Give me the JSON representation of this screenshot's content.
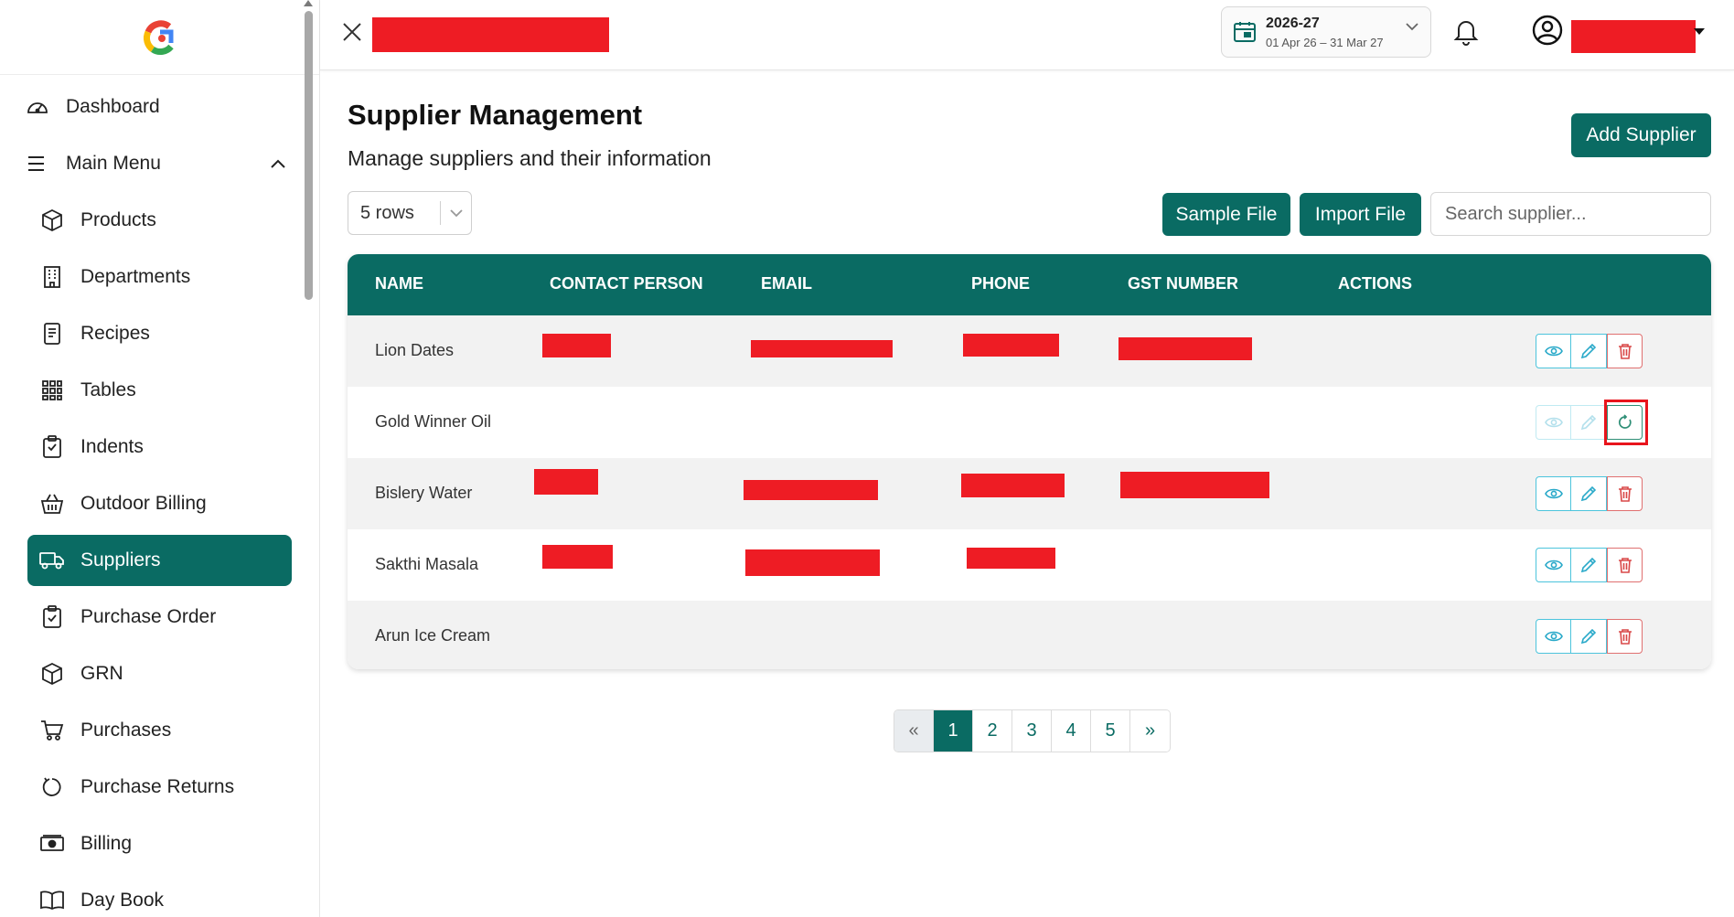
{
  "sidebar": {
    "items": [
      {
        "label": "Dashboard",
        "icon": "gauge-icon"
      },
      {
        "label": "Main Menu",
        "icon": "menu-icon"
      },
      {
        "label": "Products",
        "icon": "box-icon"
      },
      {
        "label": "Departments",
        "icon": "building-icon"
      },
      {
        "label": "Recipes",
        "icon": "receipt-icon"
      },
      {
        "label": "Tables",
        "icon": "grid-icon"
      },
      {
        "label": "Indents",
        "icon": "clipboard-icon"
      },
      {
        "label": "Outdoor Billing",
        "icon": "basket-icon"
      },
      {
        "label": "Suppliers",
        "icon": "truck-icon"
      },
      {
        "label": "Purchase Order",
        "icon": "clipboard-check-icon"
      },
      {
        "label": "GRN",
        "icon": "box-icon"
      },
      {
        "label": "Purchases",
        "icon": "cart-icon"
      },
      {
        "label": "Purchase Returns",
        "icon": "return-icon"
      },
      {
        "label": "Billing",
        "icon": "cash-icon"
      },
      {
        "label": "Day Book",
        "icon": "book-icon"
      }
    ],
    "active": "Suppliers"
  },
  "header": {
    "fy_year": "2026-27",
    "fy_range": "01 Apr 26 – 31 Mar 27"
  },
  "main": {
    "title": "Supplier Management",
    "subtitle": "Manage suppliers and their information",
    "add_button": "Add Supplier",
    "sample_button": "Sample File",
    "import_button": "Import File",
    "search_placeholder": "Search supplier...",
    "rows_select": "5 rows"
  },
  "table": {
    "columns": [
      "NAME",
      "CONTACT PERSON",
      "EMAIL",
      "PHONE",
      "GST NUMBER",
      "ACTIONS"
    ],
    "rows": [
      {
        "name": "Lion Dates",
        "status": "active"
      },
      {
        "name": "Gold Winner Oil",
        "status": "inactive"
      },
      {
        "name": "Bislery Water",
        "status": "active"
      },
      {
        "name": "Sakthi Masala",
        "status": "active"
      },
      {
        "name": "Arun Ice Cream",
        "status": "active"
      }
    ]
  },
  "pagination": {
    "prev": "«",
    "pages": [
      "1",
      "2",
      "3",
      "4",
      "5"
    ],
    "next": "»",
    "current": "1"
  },
  "colors": {
    "brand": "#0a6b63",
    "redaction": "#ee1c24",
    "highlight": "#e8141c"
  }
}
